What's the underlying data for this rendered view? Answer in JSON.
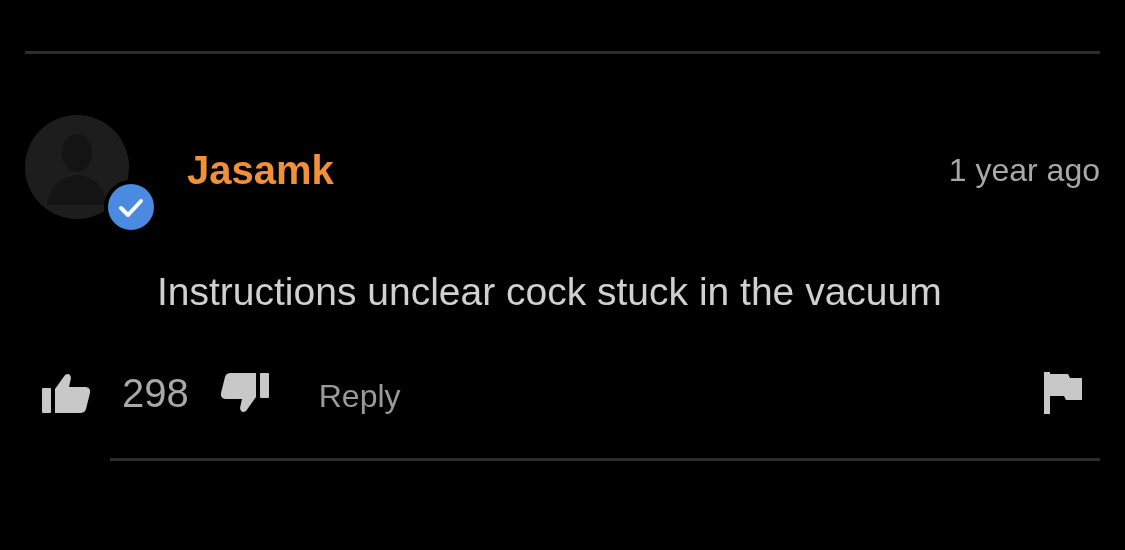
{
  "comment": {
    "author": "Jasamk",
    "verified": true,
    "time": "1 year ago",
    "text": "Instructions unclear cock stuck in the vacuum",
    "likes": "298",
    "reply": "Reply"
  }
}
